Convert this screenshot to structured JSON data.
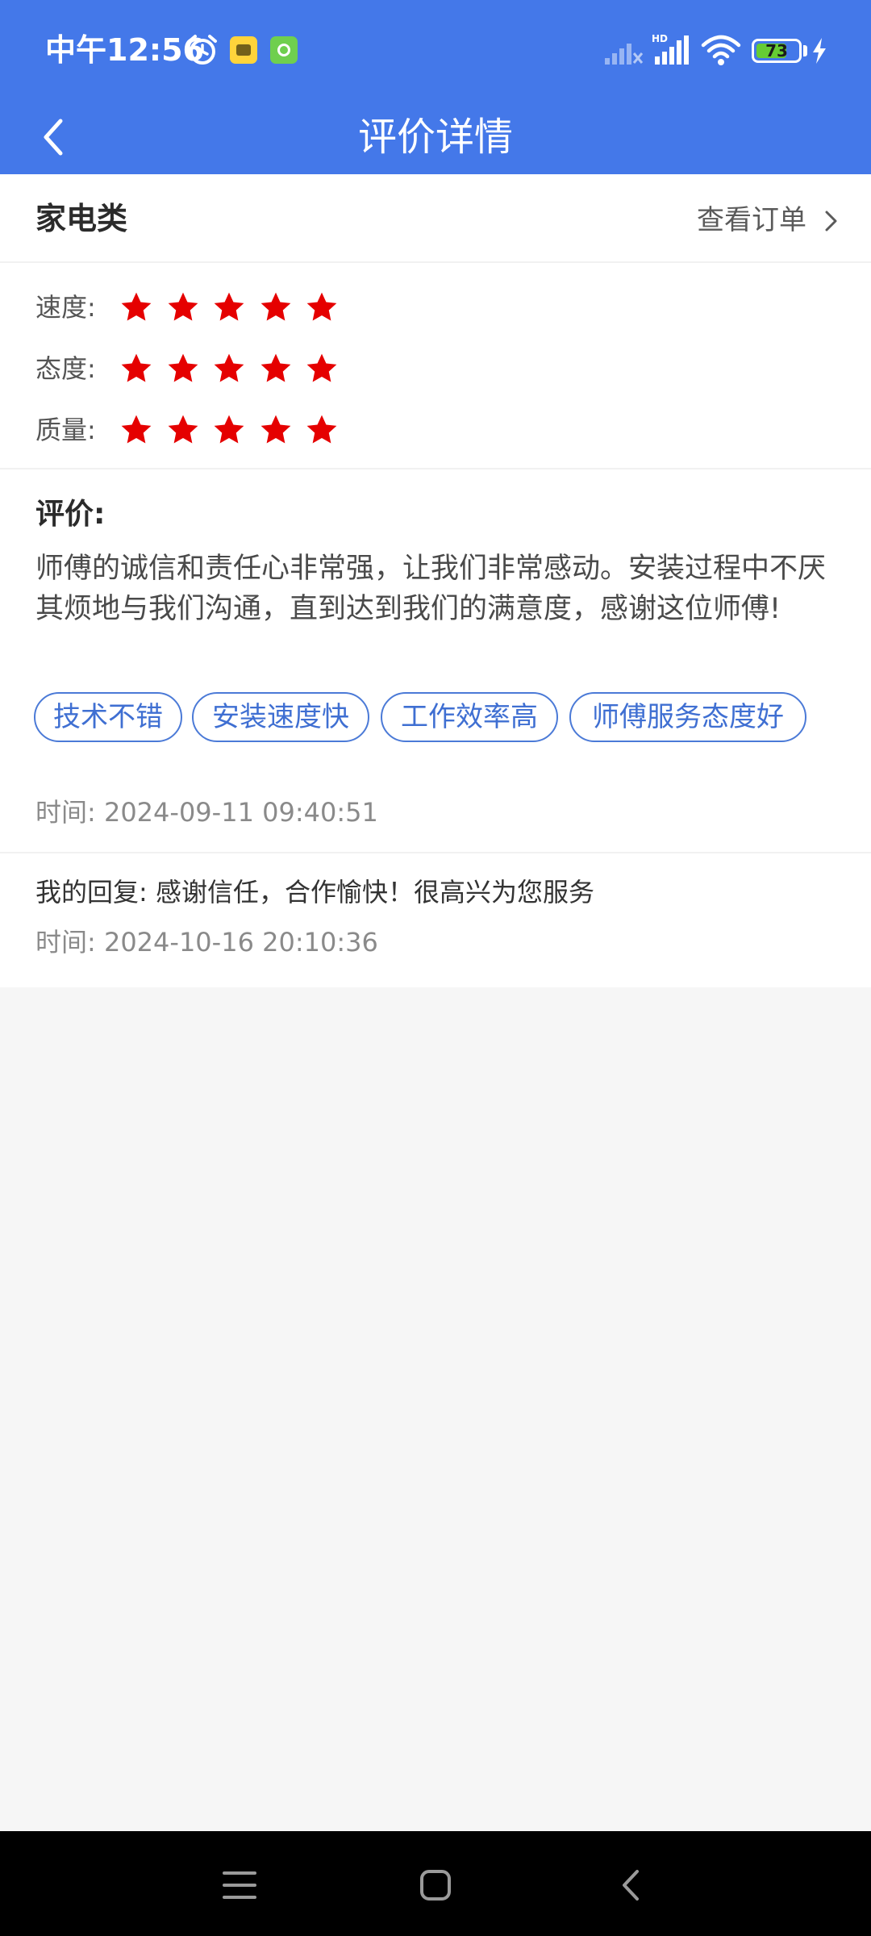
{
  "status_bar": {
    "time": "中午12:56",
    "battery_level": "73",
    "battery_fraction": 0.73,
    "network_label": "HD",
    "icons": [
      "alarm-icon",
      "app-notification-icon",
      "app-notification-icon",
      "signal-off-icon",
      "signal-hd-icon",
      "wifi-icon",
      "battery-icon",
      "charging-icon"
    ]
  },
  "nav": {
    "title": "评价详情",
    "back_icon": "chevron-left-icon"
  },
  "header": {
    "category": "家电类",
    "view_order_label": "查看订单",
    "view_order_icon": "chevron-right-icon"
  },
  "ratings": [
    {
      "label": "速度:",
      "stars": 5,
      "max_stars": 5
    },
    {
      "label": "态度:",
      "stars": 5,
      "max_stars": 5
    },
    {
      "label": "质量:",
      "stars": 5,
      "max_stars": 5
    }
  ],
  "review": {
    "heading": "评价:",
    "text": "师傅的诚信和责任心非常强，让我们非常感动。安装过程中不厌其烦地与我们沟通，直到达到我们的满意度，感谢这位师傅!",
    "tags": [
      "技术不错",
      "安装速度快",
      "工作效率高",
      "师傅服务态度好"
    ],
    "time": "时间:  2024-09-11 09:40:51"
  },
  "reply": {
    "text": "我的回复:  感谢信任，合作愉快！很高兴为您服务",
    "time": "时间:  2024-10-16 20:10:36"
  },
  "colors": {
    "header_blue": "#4478e9",
    "star_red": "#e50000",
    "tag_blue": "#3f6fd2",
    "page_bg": "#f6f6f6"
  },
  "system_nav": {
    "icons": [
      "menu-icon",
      "home-icon",
      "back-icon"
    ]
  }
}
